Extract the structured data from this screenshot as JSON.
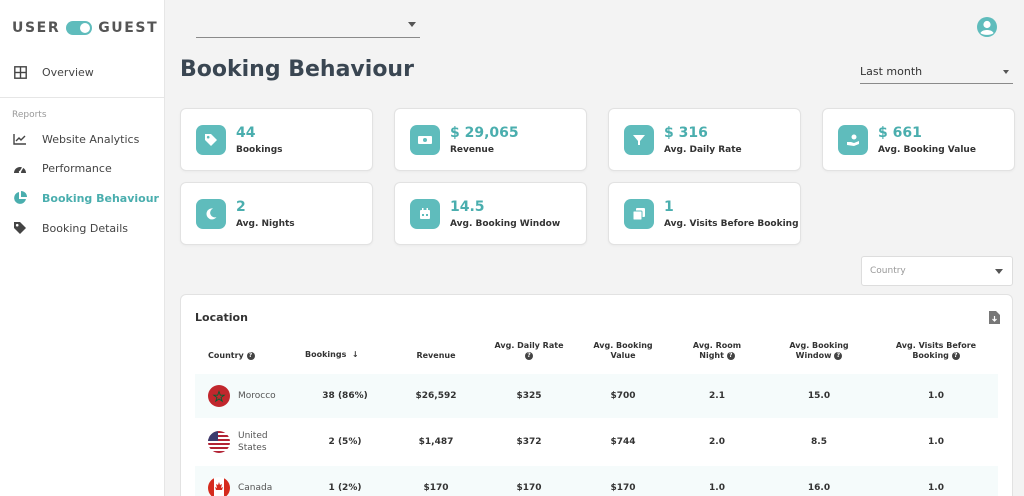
{
  "brand": {
    "left": "USER",
    "right": "GUEST"
  },
  "sidebar": {
    "overview": "Overview",
    "section_label": "Reports",
    "items": [
      {
        "label": "Website Analytics",
        "icon": "line-chart-icon"
      },
      {
        "label": "Performance",
        "icon": "speedometer-icon"
      },
      {
        "label": "Booking Behaviour",
        "icon": "pie-chart-icon",
        "active": true
      },
      {
        "label": "Booking Details",
        "icon": "tag-icon"
      }
    ]
  },
  "header": {
    "title": "Booking Behaviour",
    "period": "Last month"
  },
  "kpis": [
    {
      "value": "44",
      "label": "Bookings",
      "icon": "tag-icon"
    },
    {
      "value": "$ 29,065",
      "label": "Revenue",
      "icon": "money-icon"
    },
    {
      "value": "$ 316",
      "label": "Avg. Daily Rate",
      "icon": "filter-icon"
    },
    {
      "value": "$ 661",
      "label": "Avg. Booking Value",
      "icon": "hand-money-icon"
    },
    {
      "value": "2",
      "label": "Avg. Nights",
      "icon": "moon-icon"
    },
    {
      "value": "14.5",
      "label": "Avg. Booking Window",
      "icon": "calendar-icon"
    },
    {
      "value": "1",
      "label": "Avg. Visits Before Booking",
      "icon": "copy-icon"
    }
  ],
  "country_filter": {
    "placeholder": "Country"
  },
  "location": {
    "title": "Location",
    "columns": {
      "country": "Country",
      "bookings": "Bookings",
      "revenue": "Revenue",
      "adr_1": "Avg. Daily Rate",
      "abv_1": "Avg. Booking",
      "abv_2": "Value",
      "arn_1": "Avg. Room",
      "arn_2": "Night",
      "abw_1": "Avg. Booking",
      "abw_2": "Window",
      "avb_1": "Avg. Visits Before",
      "avb_2": "Booking"
    },
    "rows": [
      {
        "country_1": "Morocco",
        "country_2": "",
        "bookings": "38 (86%)",
        "revenue": "$26,592",
        "adr": "$325",
        "abv": "$700",
        "arn": "2.1",
        "abw": "15.0",
        "avb": "1.0"
      },
      {
        "country_1": "United",
        "country_2": "States",
        "bookings": "2 (5%)",
        "revenue": "$1,487",
        "adr": "$372",
        "abv": "$744",
        "arn": "2.0",
        "abw": "8.5",
        "avb": "1.0"
      },
      {
        "country_1": "Canada",
        "country_2": "",
        "bookings": "1 (2%)",
        "revenue": "$170",
        "adr": "$170",
        "abv": "$170",
        "arn": "1.0",
        "abw": "16.0",
        "avb": "1.0"
      }
    ]
  },
  "colors": {
    "accent": "#5fbcbc",
    "accent_dark": "#4aaeae",
    "row_shade": "#f5fbfb"
  }
}
